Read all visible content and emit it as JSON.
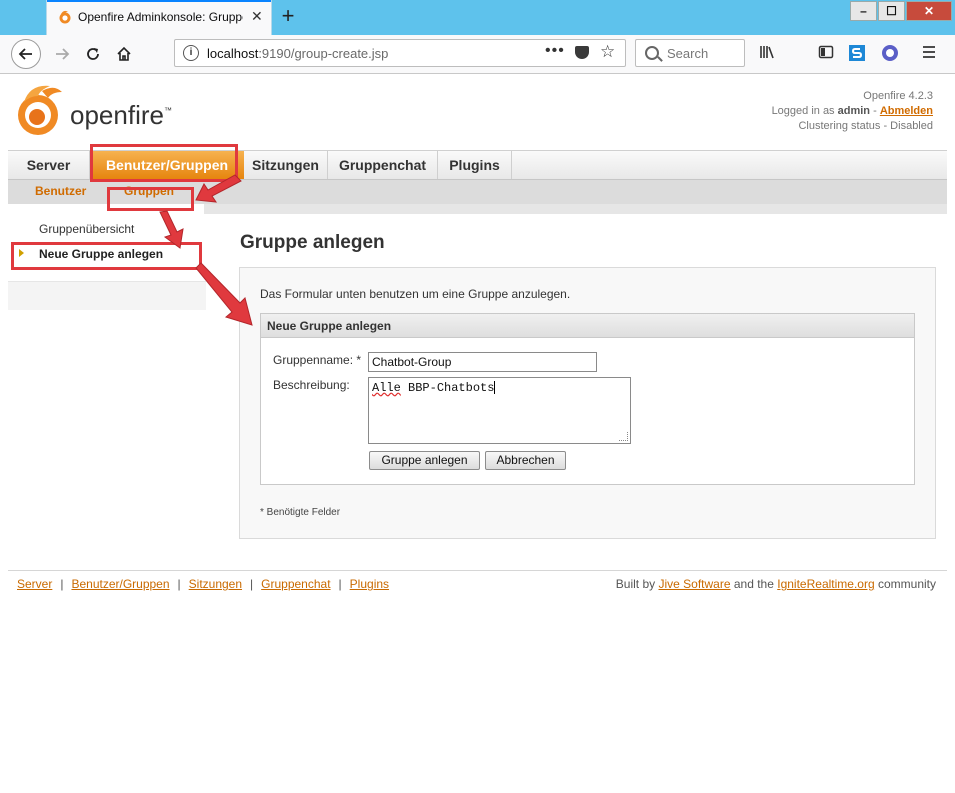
{
  "browser": {
    "tab_title": "Openfire Adminkonsole: Gruppe",
    "tab_close": "✕",
    "new_tab": "+",
    "url_host": "localhost",
    "url_path": ":9190/group-create.jsp",
    "url_more": "•••",
    "search_placeholder": "Search",
    "window_minimize": "–",
    "window_maximize": "☐",
    "window_close": "✕"
  },
  "header": {
    "logo_text": "openfire",
    "logo_tm": "™",
    "version": "Openfire 4.2.3",
    "logged_in_prefix": "Logged in as",
    "user": "admin",
    "logout": "Abmelden",
    "clustering": "Clustering status - Disabled"
  },
  "main_tabs": [
    {
      "label": "Server"
    },
    {
      "label": "Benutzer/Gruppen"
    },
    {
      "label": "Sitzungen"
    },
    {
      "label": "Gruppenchat"
    },
    {
      "label": "Plugins"
    }
  ],
  "sub_tabs": [
    {
      "label": "Benutzer"
    },
    {
      "label": "Gruppen"
    }
  ],
  "sidebar": {
    "items": [
      {
        "label": "Gruppenübersicht"
      },
      {
        "label": "Neue Gruppe anlegen"
      }
    ]
  },
  "content": {
    "title": "Gruppe anlegen",
    "intro": "Das Formular unten benutzen um eine Gruppe anzulegen.",
    "form_title": "Neue Gruppe anlegen",
    "name_label": "Gruppenname: *",
    "name_value": "Chatbot-Group",
    "desc_label": "Beschreibung:",
    "desc_spell_word": "Alle",
    "desc_rest": " BBP-Chatbots",
    "create_button": "Gruppe anlegen",
    "cancel_button": "Abbrechen",
    "required_note": "* Benötigte Felder"
  },
  "footer": {
    "links": [
      "Server",
      "Benutzer/Gruppen",
      "Sitzungen",
      "Gruppenchat",
      "Plugins"
    ],
    "separator": "|",
    "built_by": "Built by",
    "jive": "Jive Software",
    "and_the": "and the",
    "ignite": "IgniteRealtime.org",
    "community": "community"
  },
  "colors": {
    "accent_orange": "#e6850e",
    "link_orange": "#c96a00",
    "annotation_red": "#e0393e",
    "titlebar_blue": "#5ec2ec"
  }
}
